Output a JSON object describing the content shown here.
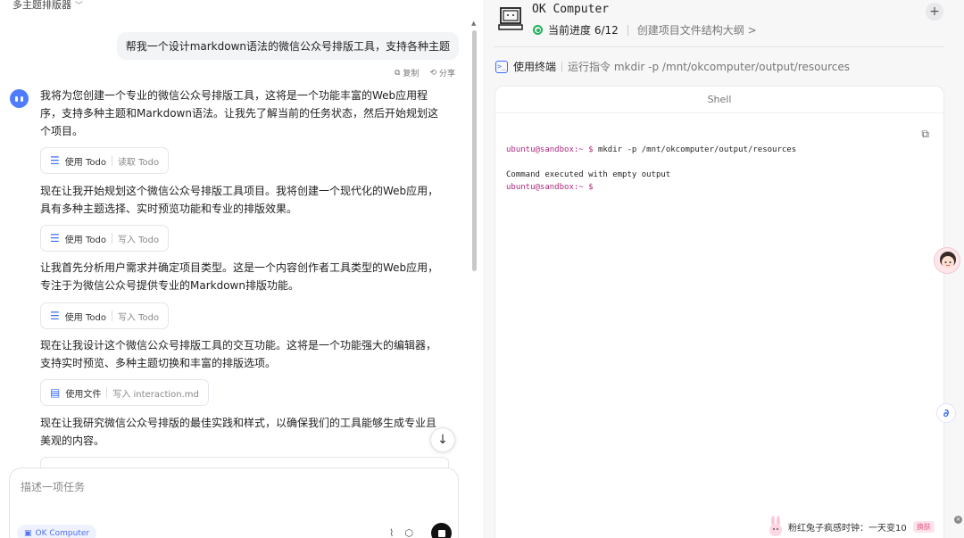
{
  "left": {
    "topbar_label": "多主题排版器",
    "user_message": "帮我一个设计markdown语法的微信公众号排版工具，支持各种主题",
    "msg_actions": {
      "copy": "复制",
      "share": "分享"
    },
    "paragraphs": [
      "我将为您创建一个专业的微信公众号排版工具，这将是一个功能丰富的Web应用程序，支持多种主题和Markdown语法。让我先了解当前的任务状态，然后开始规划这个项目。",
      "现在让我开始规划这个微信公众号排版工具项目。我将创建一个现代化的Web应用，具有多种主题选择、实时预览功能和专业的排版效果。",
      "让我首先分析用户需求并确定项目类型。这是一个内容创作者工具类型的Web应用，专注于为微信公众号提供专业的Markdown排版功能。",
      "现在让我设计这个微信公众号排版工具的交互功能。这将是一个功能强大的编辑器，支持实时预览、多种主题切换和丰富的排版选项。",
      "现在让我研究微信公众号排版的最佳实践和样式，以确保我们的工具能够生成专业且美观的内容。"
    ],
    "tools": [
      {
        "label": "使用 Todo",
        "sub": "读取 Todo"
      },
      {
        "label": "使用 Todo",
        "sub": "写入 Todo"
      },
      {
        "label": "使用 Todo",
        "sub": "写入 Todo"
      },
      {
        "label": "使用文件",
        "sub": "写入 interaction.md"
      }
    ],
    "input": {
      "placeholder": "描述一项任务",
      "agent_chip": "OK Computer"
    }
  },
  "right": {
    "title": "OK Computer",
    "progress_label": "当前进度 6/12",
    "current_task": "创建项目文件结构大纲 >",
    "terminal_label": "使用终端",
    "terminal_cmd": "运行指令 mkdir -p /mnt/okcomputer/output/resources",
    "shell_title": "Shell",
    "shell": {
      "prompt": "ubuntu@sandbox:~ $",
      "command": " mkdir -p /mnt/okcomputer/output/resources",
      "output": "Command executed with empty output",
      "prompt2": "ubuntu@sandbox:~ $"
    }
  },
  "ad": {
    "text": "粉红兔子疯感时钟：一天变10",
    "tag": "换肤"
  }
}
